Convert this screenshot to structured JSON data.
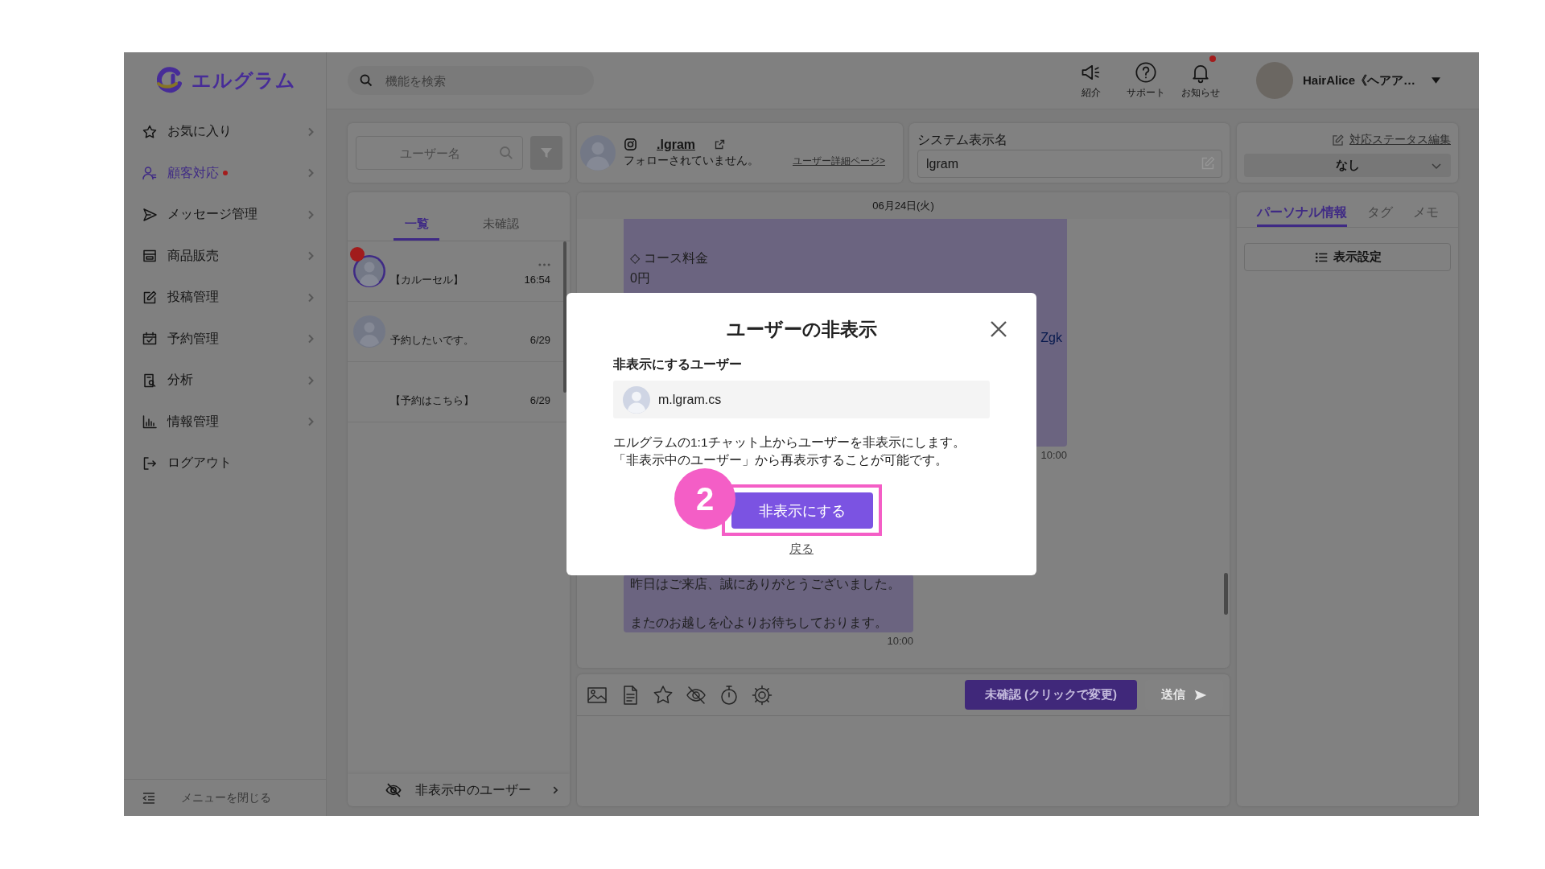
{
  "sidebar": {
    "logo": "エルグラム",
    "items": [
      {
        "label": "お気に入り",
        "selected": false,
        "badge": false,
        "submenu": true
      },
      {
        "label": "顧客対応",
        "selected": true,
        "badge": true,
        "submenu": true
      },
      {
        "label": "メッセージ管理",
        "selected": false,
        "badge": false,
        "submenu": true
      },
      {
        "label": "商品販売",
        "selected": false,
        "badge": false,
        "submenu": true
      },
      {
        "label": "投稿管理",
        "selected": false,
        "badge": false,
        "submenu": true
      },
      {
        "label": "予約管理",
        "selected": false,
        "badge": false,
        "submenu": true
      },
      {
        "label": "分析",
        "selected": false,
        "badge": false,
        "submenu": true
      },
      {
        "label": "情報管理",
        "selected": false,
        "badge": false,
        "submenu": true
      },
      {
        "label": "ログアウト",
        "selected": false,
        "badge": false,
        "submenu": false
      }
    ],
    "collapse_label": "メニューを閉じる"
  },
  "header": {
    "search": {
      "placeholder": "機能を検索"
    },
    "actions": [
      {
        "label": "紹介",
        "badge": false
      },
      {
        "label": "サポート",
        "badge": false
      },
      {
        "label": "お知らせ",
        "badge": true
      }
    ],
    "account": {
      "name": "HairAlice《ヘアア…"
    }
  },
  "chat_list": {
    "search": {
      "placeholder": "ユーザー名"
    },
    "tabs": [
      {
        "label": "一覧",
        "selected": true
      },
      {
        "label": "未確認",
        "selected": false
      }
    ],
    "conversations": [
      {
        "preview": "【カルーセル】",
        "time": "16:54",
        "avatar": true,
        "unread": true,
        "menu": true
      },
      {
        "preview": "予約したいです。",
        "time": "6/29",
        "avatar": true,
        "unread": false,
        "menu": false
      },
      {
        "preview": "【予約はこちら】",
        "time": "6/29",
        "avatar": false,
        "unread": false,
        "menu": false
      }
    ],
    "hidden_users_link": "非表示中のユーザー"
  },
  "profile": {
    "username": ".lgram",
    "follow_status": "フォローされていません。",
    "detail_link": "ユーザー詳細ページ>"
  },
  "display_name": {
    "label": "システム表示名",
    "value": "lgram"
  },
  "chat": {
    "date": "06月24日(火)",
    "messages": [
      {
        "lines": [
          "◇ コース料金",
          "0円"
        ],
        "link": "Zgk",
        "time": "10:00"
      },
      {
        "lines": [
          "昨日はご来店、誠にありがとうございました。",
          "またのお越しを心よりお待ちしております。"
        ],
        "time": "10:00"
      }
    ]
  },
  "composer": {
    "status_button": "未確認 (クリックで変更)",
    "send_button": {
      "label": "送信",
      "disabled": true
    }
  },
  "status": {
    "edit_link": "対応ステータス編集",
    "value": "なし"
  },
  "info": {
    "tabs": [
      {
        "label": "パーソナル情報",
        "selected": true
      },
      {
        "label": "タグ",
        "selected": false
      },
      {
        "label": "メモ",
        "selected": false
      }
    ],
    "display_settings_button": "表示設定"
  },
  "dialog": {
    "title": "ユーザーの非表示",
    "field_label": "非表示にするユーザー",
    "user": "m.lgram.cs",
    "description": [
      "エルグラムの1:1チャット上からユーザーを非表示にします。",
      "「非表示中のユーザー」から再表示することが可能です。"
    ],
    "confirm_button": {
      "label": "非表示にする",
      "highlighted": true
    },
    "back_link": "戻る"
  },
  "callout": {
    "number": "2"
  }
}
